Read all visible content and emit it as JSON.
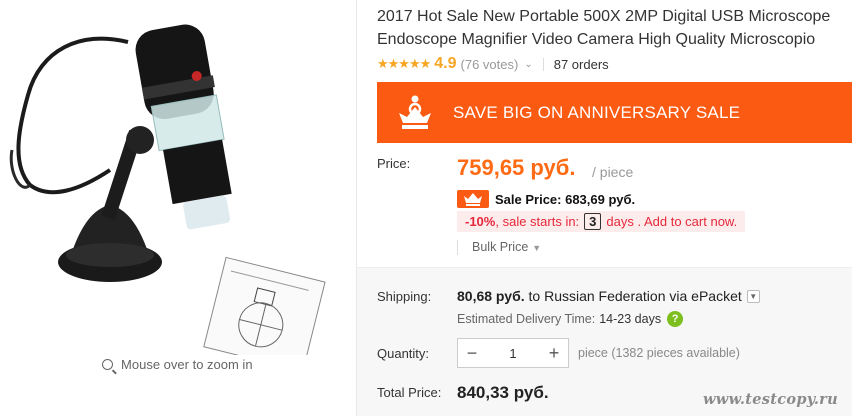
{
  "gallery": {
    "zoom_hint": "Mouse over to zoom in",
    "icons": [
      "magnifier-icon"
    ]
  },
  "product": {
    "title": "2017 Hot Sale New Portable 500X 2MP Digital USB Microscope Endoscope Magnifier Video Camera High Quality Microscopio",
    "stars": "★★★★★",
    "rating": "4.9",
    "votes": "(76 votes)",
    "orders": "87 orders"
  },
  "banner": {
    "text": "SAVE BIG ON ANNIVERSARY SALE",
    "color": "#fa5a11",
    "icon": "crown-icon"
  },
  "price": {
    "label": "Price:",
    "value": "759,65 руб.",
    "unit": "/ piece",
    "sale_label": "Sale Price: 683,69 руб.",
    "discount": "-10%",
    "sale_starts": ", sale starts in:",
    "days_count": "3",
    "days_suffix": "days . Add to cart now.",
    "bulk_label": "Bulk Price",
    "accent_color": "#ff6a14"
  },
  "shipping": {
    "label": "Shipping:",
    "cost": "80,68 руб.",
    "to_text": "to Russian Federation via ePacket",
    "delivery_label": "Estimated Delivery Time:",
    "delivery_days": "14-23 days",
    "help_glyph": "?"
  },
  "quantity": {
    "label": "Quantity:",
    "minus": "−",
    "value": "1",
    "plus": "+",
    "info": "piece (1382 pieces available)"
  },
  "total": {
    "label": "Total Price:",
    "value": "840,33 руб."
  },
  "watermark": "www.testcopy.ru"
}
